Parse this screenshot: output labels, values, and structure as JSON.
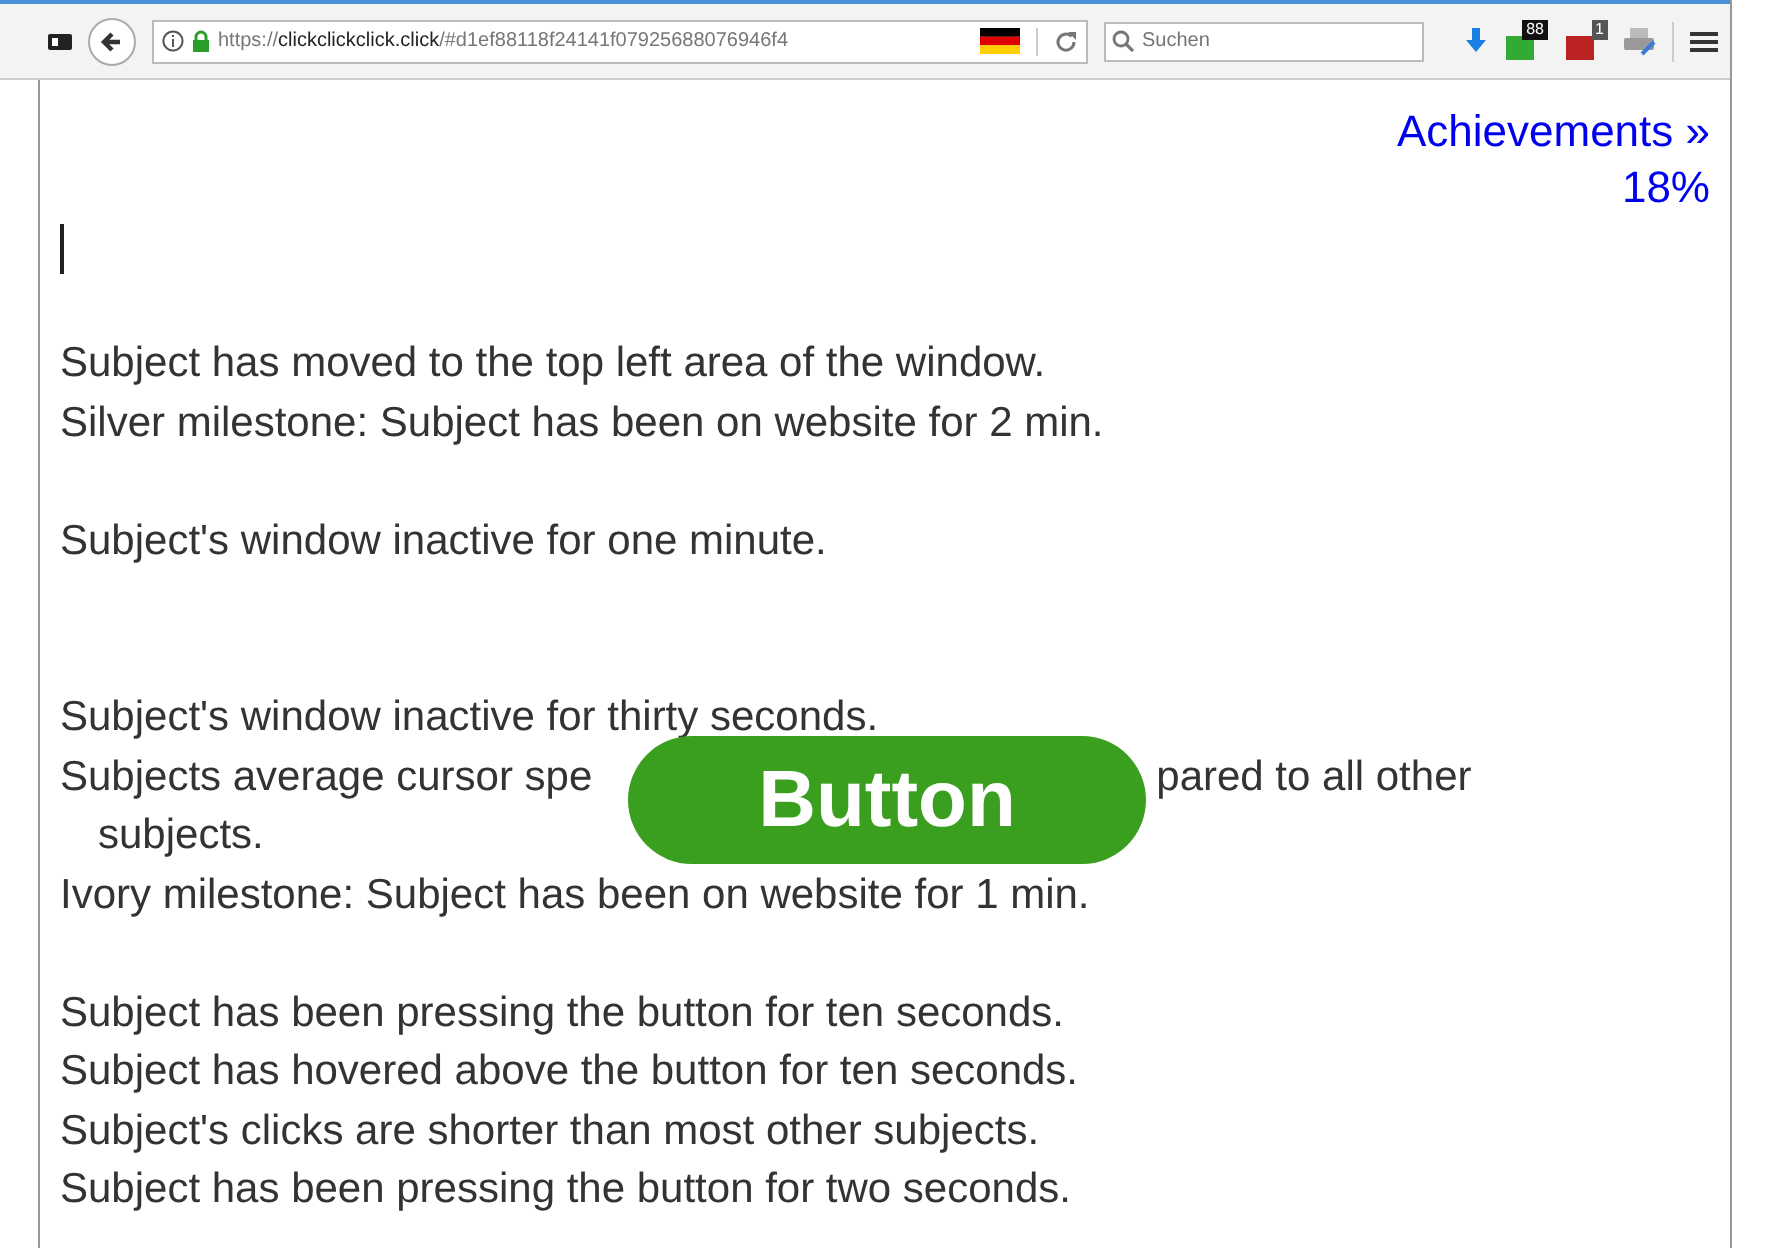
{
  "browser": {
    "url_prefix": "https://",
    "url_host": "clickclickclick.click",
    "url_path": "/#d1ef88118f24141f07925688076946f4",
    "search_placeholder": "Suchen",
    "badges": [
      {
        "text": "88",
        "kind": "green"
      },
      {
        "text": "1",
        "kind": "red"
      }
    ]
  },
  "achievements": {
    "link": "Achievements »",
    "percent": "18%"
  },
  "log": [
    {
      "kind": "cursor"
    },
    {
      "kind": "blank"
    },
    {
      "kind": "line",
      "text": "Subject has moved to the top left area of the window."
    },
    {
      "kind": "line",
      "text": "Silver milestone: Subject has been on website for 2 min."
    },
    {
      "kind": "blank"
    },
    {
      "kind": "line",
      "text": "Subject's window inactive for one minute."
    },
    {
      "kind": "blank"
    },
    {
      "kind": "blank"
    },
    {
      "kind": "line",
      "text": "Subject's window inactive for thirty seconds."
    },
    {
      "kind": "covered",
      "before": "Subjects average cursor spe",
      "after": "pared to all other",
      "wrap": "subjects."
    },
    {
      "kind": "line",
      "text": "Ivory milestone: Subject has been on website for 1 min."
    },
    {
      "kind": "blank"
    },
    {
      "kind": "line",
      "text": "Subject has been pressing the button for ten seconds."
    },
    {
      "kind": "line",
      "text": "Subject has hovered above the button for ten seconds."
    },
    {
      "kind": "line",
      "text": "Subject's clicks are shorter than most other subjects."
    },
    {
      "kind": "line",
      "text": "Subject has been pressing the button for two seconds."
    }
  ],
  "button": {
    "label": "Button"
  }
}
